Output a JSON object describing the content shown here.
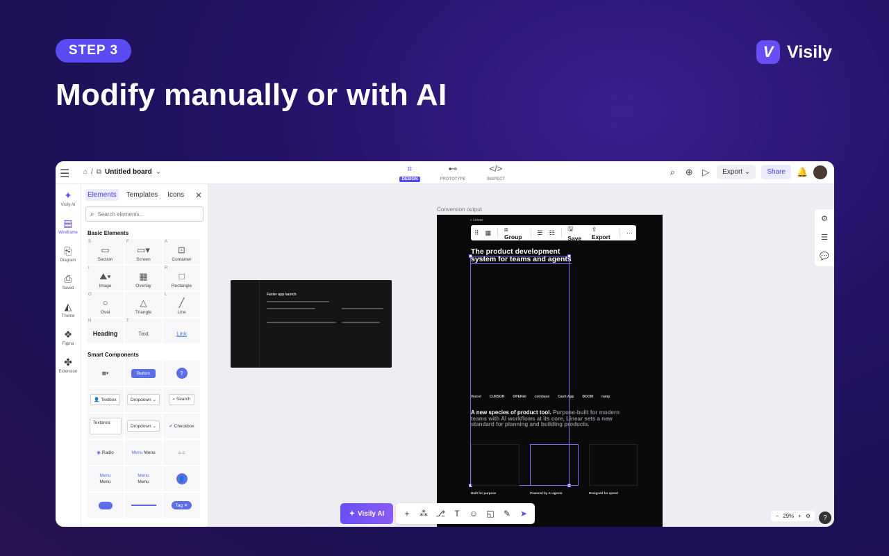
{
  "banner": {
    "step": "STEP 3",
    "headline": "Modify manually or with AI",
    "brand_name": "Visily",
    "brand_color": "#6a4ef5"
  },
  "topbar": {
    "board_name": "Untitled board",
    "modes": [
      {
        "label": "DESIGN",
        "icon": "design-icon",
        "active": true
      },
      {
        "label": "PROTOTYPE",
        "icon": "prototype-icon",
        "active": false
      },
      {
        "label": "INSPECT",
        "icon": "inspect-icon",
        "active": false
      }
    ],
    "export_label": "Export",
    "share_label": "Share"
  },
  "rail": {
    "items": [
      {
        "label": "Visily AI",
        "icon": "sparkle-icon"
      },
      {
        "label": "Wireframe",
        "icon": "wireframe-icon"
      },
      {
        "label": "Diagram",
        "icon": "diagram-icon"
      },
      {
        "label": "Saved",
        "icon": "saved-icon"
      },
      {
        "label": "Theme",
        "icon": "theme-icon"
      },
      {
        "label": "Figma",
        "icon": "figma-icon"
      },
      {
        "label": "Extension",
        "icon": "extension-icon"
      }
    ]
  },
  "panel": {
    "tabs": [
      "Elements",
      "Templates",
      "Icons"
    ],
    "search_placeholder": "Search elements...",
    "basic_title": "Basic Elements",
    "basic": [
      {
        "key": "S",
        "name": "Section",
        "glyph": "▭"
      },
      {
        "key": "F",
        "name": "Screen",
        "glyph": "▭"
      },
      {
        "key": "A",
        "name": "Container",
        "glyph": "★"
      },
      {
        "key": "I",
        "name": "Image",
        "glyph": "🖼"
      },
      {
        "key": "",
        "name": "Overlay",
        "glyph": "▦"
      },
      {
        "key": "R",
        "name": "Rectangle",
        "glyph": "□"
      },
      {
        "key": "O",
        "name": "Oval",
        "glyph": "○"
      },
      {
        "key": "",
        "name": "Triangle",
        "glyph": "△"
      },
      {
        "key": "L",
        "name": "Line",
        "glyph": "╱"
      },
      {
        "key": "H",
        "name": "Heading",
        "glyph": "Heading"
      },
      {
        "key": "T",
        "name": "Text",
        "glyph": "Text"
      },
      {
        "key": "",
        "name": "",
        "glyph": "Link"
      }
    ],
    "smart_title": "Smart Components",
    "smart": {
      "button": "Button",
      "help": "?",
      "textbox": "Textbox",
      "dropdown": "Dropdown",
      "search": "Search",
      "textarea": "Textarea",
      "dropdown2": "Dropdown",
      "checkbox": "Checkbox",
      "radio": "Radio",
      "menu": "Menu",
      "tag": "Tag"
    }
  },
  "canvas": {
    "conversion_label": "Conversion output",
    "page_title": "The product development system for teams and agents",
    "section_title": "A new species of product tool.",
    "section_muted": "Purpose-built for modern teams with AI workflows at its core, Linear sets a new standard for planning and building products.",
    "logos": [
      "Vercel",
      "CURSOR",
      "OPENAI",
      "coinbase",
      "Cash App",
      "BOOM",
      "ramp"
    ],
    "features": [
      "Built for purpose",
      "Powered by AI agents",
      "Designed for speed"
    ],
    "toolbar": {
      "group": "Group",
      "save": "Save",
      "export": "Export"
    }
  },
  "bottom": {
    "ai_label": "Visily AI",
    "zoom": "29%"
  }
}
